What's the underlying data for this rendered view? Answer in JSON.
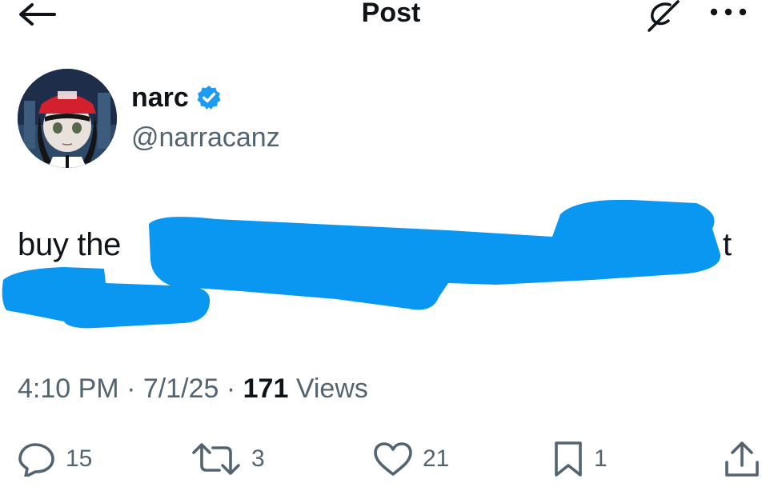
{
  "header": {
    "title": "Post",
    "back_icon": "arrow-left-icon",
    "grok_icon": "grok-icon",
    "more_icon": "more-icon"
  },
  "author": {
    "name": "narc",
    "handle": "@narracanz",
    "verified": true,
    "verified_color": "#1d9bf0"
  },
  "tweet": {
    "text_visible_start": "buy the",
    "text_visible_end": "t",
    "redaction_color": "#0a97f2"
  },
  "meta": {
    "time": "4:10 PM",
    "date": "7/1/25",
    "views_count": "171",
    "views_label": "Views",
    "separator": "·"
  },
  "actions": {
    "replies": "15",
    "reposts": "3",
    "likes": "21",
    "bookmarks": "1"
  }
}
